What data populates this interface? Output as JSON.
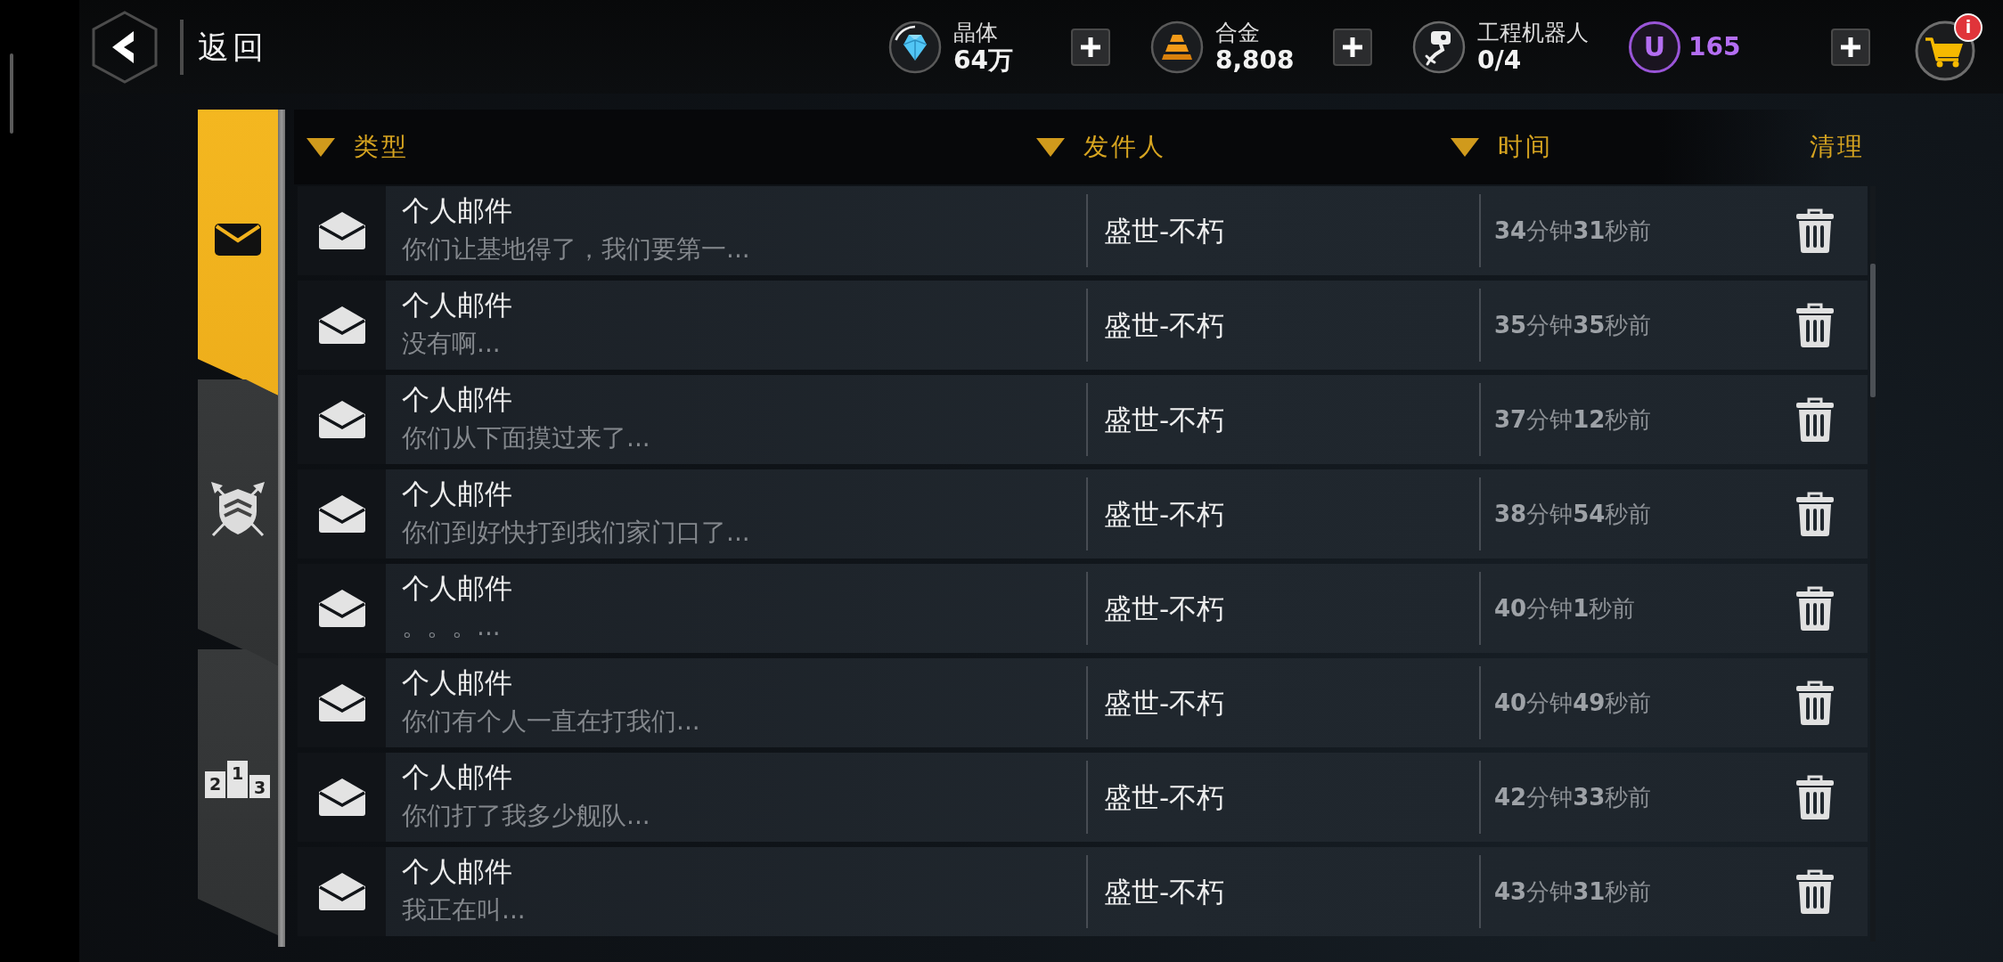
{
  "header": {
    "back_label": "返回"
  },
  "resources": [
    {
      "kind": "crystal",
      "label": "晶体",
      "value": "64万",
      "has_add_button": true
    },
    {
      "kind": "alloy",
      "label": "合金",
      "value": "8,808",
      "has_add_button": true
    },
    {
      "kind": "robot",
      "label": "工程机器人",
      "value": "0/4",
      "has_add_button": false
    },
    {
      "kind": "premium",
      "symbol": "U",
      "value": "165",
      "has_add_button": true
    }
  ],
  "cart": {
    "badge": "i"
  },
  "tabs": [
    {
      "kind": "mail",
      "selected": true
    },
    {
      "kind": "alliance",
      "selected": false
    },
    {
      "kind": "ranking",
      "selected": false,
      "digits": [
        "2",
        "1",
        "3"
      ]
    }
  ],
  "table": {
    "columns": [
      {
        "label": "类型",
        "sortable": true
      },
      {
        "label": "发件人",
        "sortable": true
      },
      {
        "label": "时间",
        "sortable": true
      },
      {
        "label": "清理",
        "sortable": false
      }
    ],
    "rows": [
      {
        "type": "个人邮件",
        "preview": "你们让基地得了，我们要第一...",
        "sender": "盛世-不朽",
        "time": "**34**分钟**31**秒前",
        "read": true
      },
      {
        "type": "个人邮件",
        "preview": "没有啊...",
        "sender": "盛世-不朽",
        "time": "**35**分钟**35**秒前",
        "read": true
      },
      {
        "type": "个人邮件",
        "preview": "你们从下面摸过来了...",
        "sender": "盛世-不朽",
        "time": "**37**分钟**12**秒前",
        "read": true
      },
      {
        "type": "个人邮件",
        "preview": "你们到好快打到我们家门口了...",
        "sender": "盛世-不朽",
        "time": "**38**分钟**54**秒前",
        "read": true
      },
      {
        "type": "个人邮件",
        "preview": "。。。...",
        "sender": "盛世-不朽",
        "time": "**40**分钟**1**秒前",
        "read": true
      },
      {
        "type": "个人邮件",
        "preview": "你们有个人一直在打我们...",
        "sender": "盛世-不朽",
        "time": "**40**分钟**49**秒前",
        "read": true
      },
      {
        "type": "个人邮件",
        "preview": "你们打了我多少舰队...",
        "sender": "盛世-不朽",
        "time": "**42**分钟**33**秒前",
        "read": true
      },
      {
        "type": "个人邮件",
        "preview": "我正在叫...",
        "sender": "盛世-不朽",
        "time": "**43**分钟**31**秒前",
        "read": true
      }
    ]
  }
}
